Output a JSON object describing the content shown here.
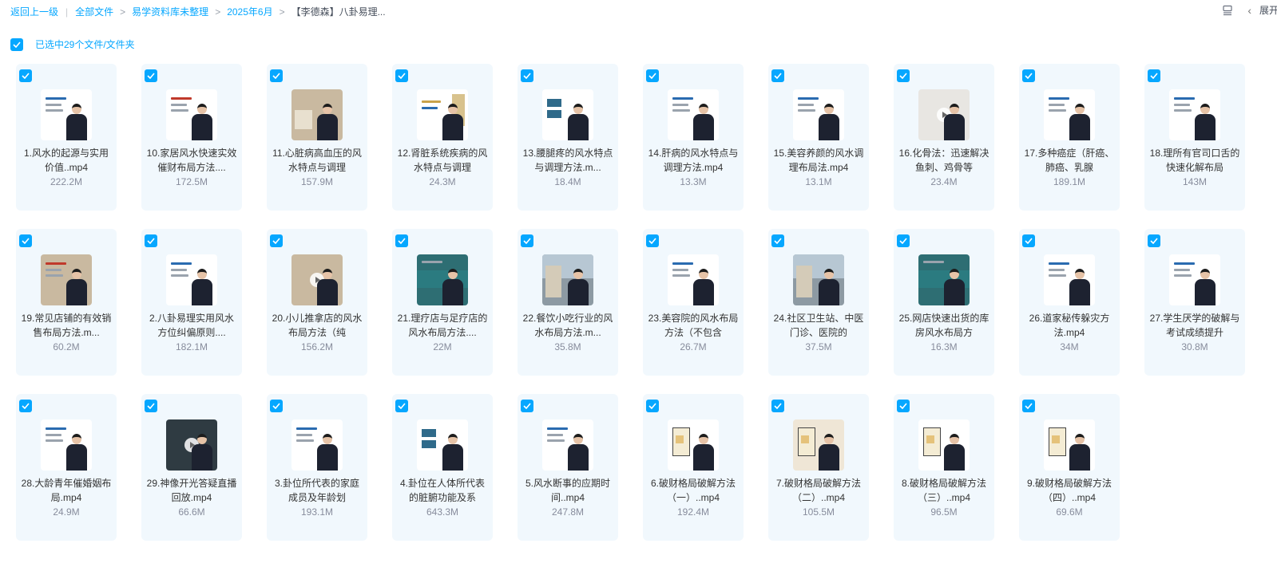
{
  "breadcrumb": {
    "back": "返回上一级",
    "items": [
      "全部文件",
      "易学资料库未整理",
      "2025年6月",
      "【李德森】八卦易理..."
    ]
  },
  "top_right": {
    "expand_label": "展开"
  },
  "selection": {
    "text": "已选中29个文件/文件夹"
  },
  "colors": {
    "accent": "#06a7ff",
    "card_bg": "#f1f8fd",
    "size_text": "#878c9c"
  },
  "files": [
    {
      "name": "1.风水的起源与实用价值..mp4",
      "size": "222.2M"
    },
    {
      "name": "10.家居风水快速实效催财布局方法....",
      "size": "172.5M"
    },
    {
      "name": "11.心脏病高血压的风水特点与调理",
      "size": "157.9M"
    },
    {
      "name": "12.肾脏系统疾病的风水特点与调理",
      "size": "24.3M"
    },
    {
      "name": "13.腰腿疼的风水特点与调理方法.m...",
      "size": "18.4M"
    },
    {
      "name": "14.肝病的风水特点与调理方法.mp4",
      "size": "13.3M"
    },
    {
      "name": "15.美容养颜的风水调理布局法.mp4",
      "size": "13.1M"
    },
    {
      "name": "16.化骨法：迅速解决鱼刺、鸡骨等",
      "size": "23.4M"
    },
    {
      "name": "17.多种癌症（肝癌、肺癌、乳腺",
      "size": "189.1M"
    },
    {
      "name": "18.理所有官司口舌的快速化解布局",
      "size": "143M"
    },
    {
      "name": "19.常见店铺的有效销售布局方法.m...",
      "size": "60.2M"
    },
    {
      "name": "2.八卦易理实用风水方位纠偏原则....",
      "size": "182.1M"
    },
    {
      "name": "20.小儿推拿店的风水布局方法（纯",
      "size": "156.2M"
    },
    {
      "name": "21.理疗店与足疗店的风水布局方法....",
      "size": "22M"
    },
    {
      "name": "22.餐饮小吃行业的风水布局方法.m...",
      "size": "35.8M"
    },
    {
      "name": "23.美容院的风水布局方法（不包含",
      "size": "26.7M"
    },
    {
      "name": "24.社区卫生站、中医门诊、医院的",
      "size": "37.5M"
    },
    {
      "name": "25.网店快速出货的库房风水布局方",
      "size": "16.3M"
    },
    {
      "name": "26.道家秘传躲灾方法.mp4",
      "size": "34M"
    },
    {
      "name": "27.学生厌学的破解与考试成绩提升",
      "size": "30.8M"
    },
    {
      "name": "28.大龄青年催婚姻布局.mp4",
      "size": "24.9M"
    },
    {
      "name": "29.神像开光答疑直播回放.mp4",
      "size": "66.6M"
    },
    {
      "name": "3.卦位所代表的家庭成员及年龄划",
      "size": "193.1M"
    },
    {
      "name": "4.卦位在人体所代表的脏腑功能及系",
      "size": "643.3M"
    },
    {
      "name": "5.风水断事的应期时间..mp4",
      "size": "247.8M"
    },
    {
      "name": "6.破财格局破解方法（一）..mp4",
      "size": "192.4M"
    },
    {
      "name": "7.破财格局破解方法（二）..mp4",
      "size": "105.5M"
    },
    {
      "name": "8.破财格局破解方法（三）..mp4",
      "size": "96.5M"
    },
    {
      "name": "9.破财格局破解方法（四）..mp4",
      "size": "69.6M"
    }
  ]
}
